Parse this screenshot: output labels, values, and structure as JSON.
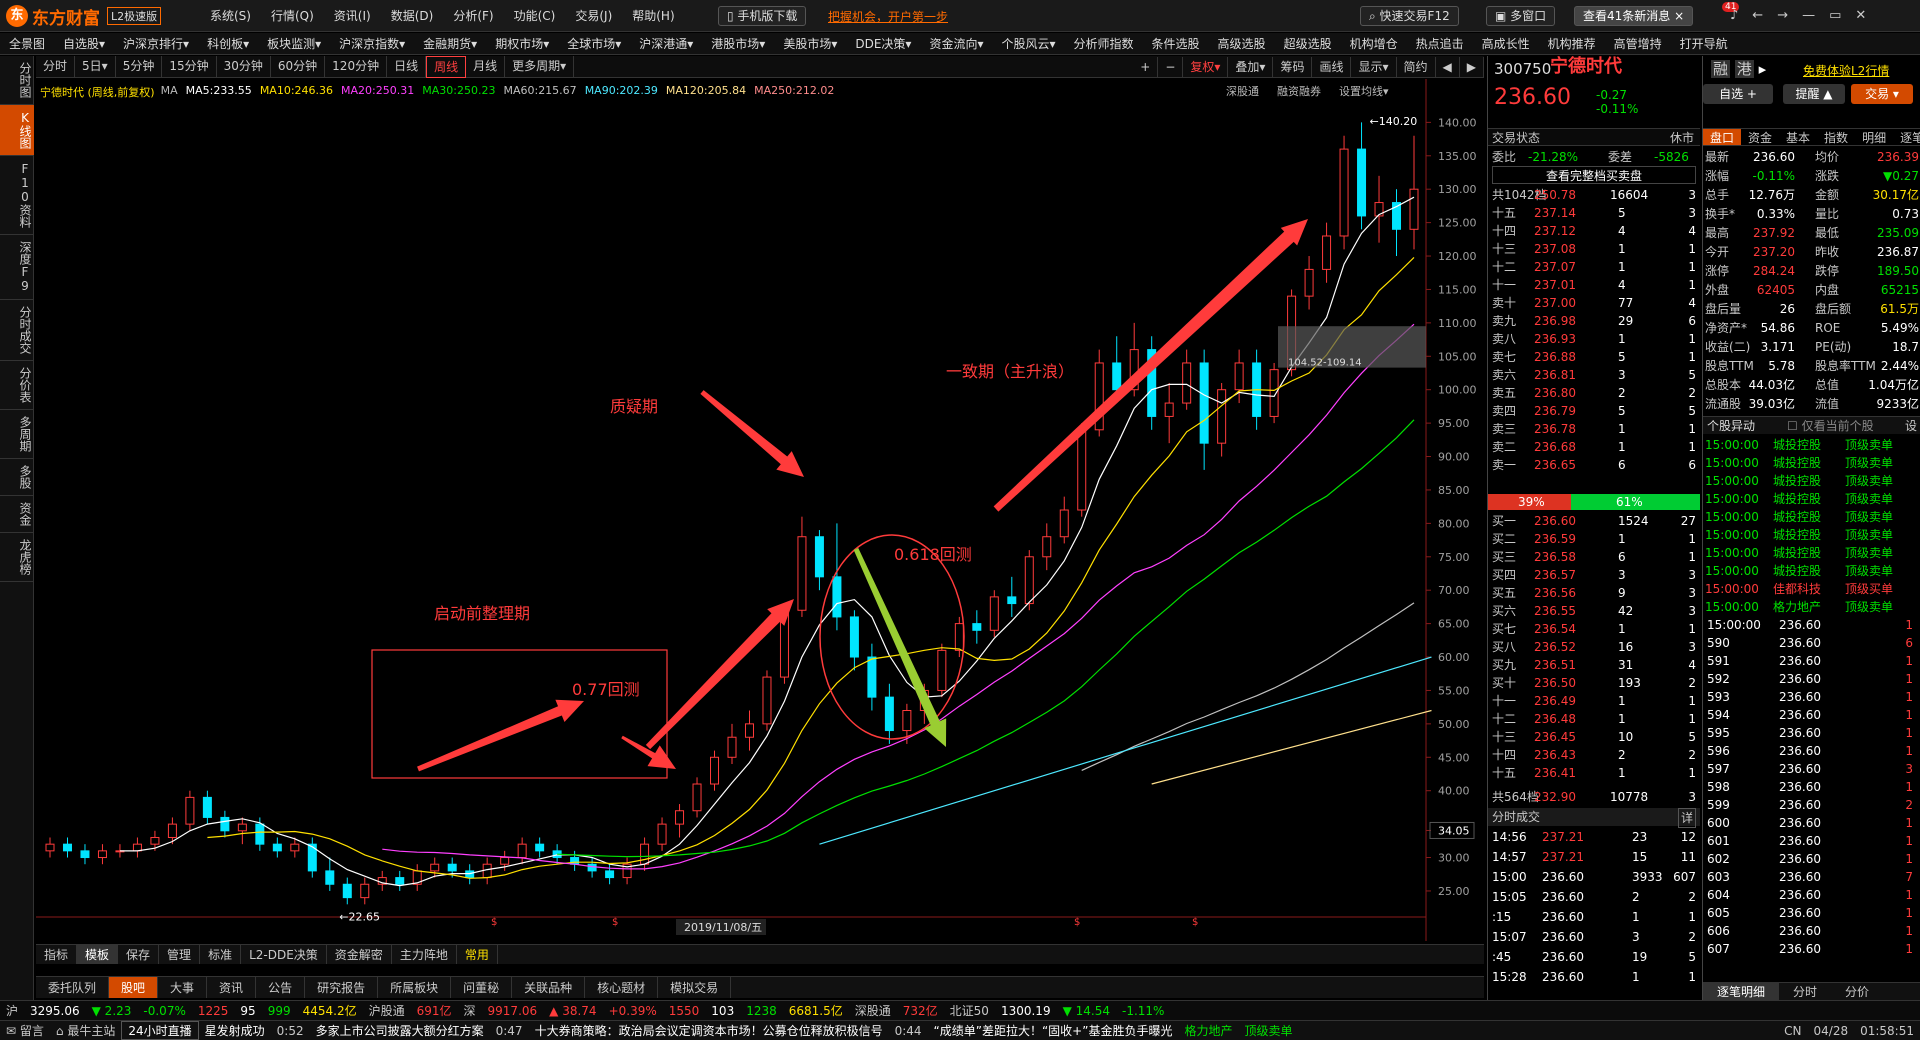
{
  "app": {
    "logo_text": "东方财富",
    "logo_sub": "L2极速版",
    "mobile_btn": "手机版下载",
    "promo": "把握机会，开户第一步",
    "quick_trade": "快速交易F12",
    "multi_window": "多窗口",
    "news": "查看41条新消息",
    "news_badge": "41"
  },
  "main_menu": [
    "系统(S)",
    "行情(Q)",
    "资讯(I)",
    "数据(D)",
    "分析(F)",
    "功能(C)",
    "交易(J)",
    "帮助(H)"
  ],
  "menubar": [
    "全景图",
    "自选股▾",
    "沪深京排行▾",
    "科创板▾",
    "板块监测▾",
    "沪深京指数▾",
    "金融期货▾",
    "期权市场▾",
    "全球市场▾",
    "沪深港通▾",
    "港股市场▾",
    "美股市场▾",
    "DDE决策▾",
    "资金流向▾",
    "个股风云▾",
    "分析师指数",
    "条件选股",
    "高级选股",
    "超级选股",
    "机构增仓",
    "热点追击",
    "高成长性",
    "机构推荐",
    "高管增持",
    "打开导航"
  ],
  "left_tabs": [
    "分时图",
    "K线图",
    "F10资料",
    "深度F9",
    "分时成交",
    "分价表",
    "多周期",
    "多股",
    "资金",
    "龙虎榜"
  ],
  "period_bar": [
    "分时",
    "5日▾",
    "5分钟",
    "15分钟",
    "30分钟",
    "60分钟",
    "120分钟",
    "日线",
    "周线",
    "月线",
    "更多周期▾"
  ],
  "period_active": "周线",
  "tool_bar": [
    "复权▾",
    "叠加▾",
    "筹码",
    "画线",
    "显示▾",
    "简约"
  ],
  "chart_subbar": [
    "深股通",
    "融资融券",
    "设置均线▾"
  ],
  "chart_data": {
    "type": "candlestick",
    "title": "宁德时代 (周线,前复权)",
    "ma_labels": [
      {
        "name": "MA5",
        "value": "233.55",
        "color": "#ffffff"
      },
      {
        "name": "MA10",
        "value": "246.36",
        "color": "#ffe000"
      },
      {
        "name": "MA20",
        "value": "250.31",
        "color": "#ff40ff"
      },
      {
        "name": "MA30",
        "value": "250.23",
        "color": "#00e000"
      },
      {
        "name": "MA60",
        "value": "215.67",
        "color": "#c0c0c0"
      },
      {
        "name": "MA90",
        "value": "202.39",
        "color": "#4de8ff"
      },
      {
        "name": "MA120",
        "value": "205.84",
        "color": "#ffe08c"
      },
      {
        "name": "MA250",
        "value": "212.02",
        "color": "#ff8c8c"
      }
    ],
    "y_ticks": [
      "140.00",
      "135.00",
      "130.00",
      "125.00",
      "120.00",
      "115.00",
      "110.00",
      "105.00",
      "100.00",
      "95.00",
      "90.00",
      "85.00",
      "80.00",
      "75.00",
      "70.00",
      "65.00",
      "60.00",
      "55.00",
      "50.00",
      "45.00",
      "40.00",
      "34.05",
      "30.00",
      "25.00"
    ],
    "ylim": [
      22,
      142
    ],
    "high_label": "140.20",
    "low_label": "22.65",
    "box_label": "104.52-109.14",
    "date_label": "2019/11/08/五",
    "candles": [
      [
        31,
        33,
        30,
        32
      ],
      [
        32,
        33,
        30,
        31
      ],
      [
        31,
        32,
        29,
        30
      ],
      [
        30,
        32,
        29,
        31
      ],
      [
        31,
        32,
        30,
        31
      ],
      [
        31,
        33,
        30,
        32
      ],
      [
        32,
        34,
        31,
        33
      ],
      [
        33,
        36,
        32,
        35
      ],
      [
        35,
        40,
        34,
        39
      ],
      [
        39,
        40,
        35,
        36
      ],
      [
        36,
        37,
        33,
        34
      ],
      [
        34,
        36,
        32,
        35
      ],
      [
        35,
        36,
        31,
        32
      ],
      [
        32,
        33,
        30,
        31
      ],
      [
        31,
        33,
        30,
        32
      ],
      [
        32,
        33,
        27,
        28
      ],
      [
        28,
        30,
        25,
        26
      ],
      [
        26,
        27,
        23,
        24
      ],
      [
        24,
        27,
        23,
        26
      ],
      [
        26,
        28,
        25,
        27
      ],
      [
        27,
        28,
        25,
        26
      ],
      [
        26,
        29,
        25,
        28
      ],
      [
        28,
        30,
        27,
        29
      ],
      [
        29,
        30,
        27,
        28
      ],
      [
        28,
        29,
        26,
        27
      ],
      [
        27,
        30,
        26,
        29
      ],
      [
        29,
        31,
        28,
        30
      ],
      [
        30,
        33,
        29,
        32
      ],
      [
        32,
        33,
        30,
        31
      ],
      [
        31,
        32,
        29,
        30
      ],
      [
        30,
        31,
        28,
        29
      ],
      [
        29,
        30,
        27,
        28
      ],
      [
        28,
        29,
        26,
        27
      ],
      [
        27,
        30,
        26,
        29
      ],
      [
        29,
        33,
        28,
        32
      ],
      [
        32,
        36,
        31,
        35
      ],
      [
        35,
        38,
        33,
        37
      ],
      [
        37,
        42,
        36,
        41
      ],
      [
        41,
        46,
        40,
        45
      ],
      [
        45,
        50,
        44,
        48
      ],
      [
        48,
        52,
        46,
        50
      ],
      [
        50,
        58,
        49,
        57
      ],
      [
        57,
        68,
        56,
        67
      ],
      [
        67,
        81,
        66,
        78
      ],
      [
        78,
        79,
        70,
        72
      ],
      [
        72,
        80,
        64,
        66
      ],
      [
        66,
        67,
        58,
        60
      ],
      [
        60,
        62,
        52,
        54
      ],
      [
        54,
        56,
        47,
        49
      ],
      [
        49,
        53,
        47,
        52
      ],
      [
        52,
        56,
        50,
        55
      ],
      [
        55,
        62,
        54,
        61
      ],
      [
        61,
        66,
        60,
        65
      ],
      [
        65,
        67,
        62,
        64
      ],
      [
        64,
        70,
        63,
        69
      ],
      [
        69,
        72,
        66,
        68
      ],
      [
        68,
        76,
        67,
        75
      ],
      [
        75,
        80,
        73,
        78
      ],
      [
        78,
        84,
        77,
        82
      ],
      [
        82,
        95,
        81,
        94
      ],
      [
        94,
        106,
        93,
        104
      ],
      [
        104,
        108,
        98,
        100
      ],
      [
        100,
        110,
        99,
        106
      ],
      [
        106,
        108,
        94,
        96
      ],
      [
        96,
        101,
        92,
        98
      ],
      [
        98,
        106,
        97,
        104
      ],
      [
        104,
        106,
        88,
        92
      ],
      [
        92,
        101,
        90,
        100
      ],
      [
        100,
        106,
        98,
        104
      ],
      [
        104,
        106,
        94,
        96
      ],
      [
        96,
        104,
        95,
        103
      ],
      [
        103,
        115,
        102,
        114
      ],
      [
        114,
        120,
        112,
        118
      ],
      [
        118,
        125,
        116,
        123
      ],
      [
        123,
        138,
        121,
        136
      ],
      [
        136,
        140,
        124,
        126
      ],
      [
        126,
        132,
        122,
        128
      ],
      [
        128,
        130,
        120,
        124
      ],
      [
        124,
        138,
        121,
        130
      ]
    ]
  },
  "annotations": {
    "consolidation": "启动前整理期",
    "retrace077": "0.77回测",
    "doubt": "质疑期",
    "retrace0618": "0.618回测",
    "consensus": "一致期（主升浪）"
  },
  "bottom_tabs": [
    "指标",
    "模板",
    "保存",
    "管理",
    "标准",
    "L2-DDE决策",
    "资金解密",
    "主力阵地",
    "常用"
  ],
  "bottom_tabs2": [
    "委托队列",
    "股吧",
    "大事",
    "资讯",
    "公告",
    "研究报告",
    "所属板块",
    "问董秘",
    "关联品种",
    "核心题材",
    "模拟交易"
  ],
  "stock": {
    "code": "300750",
    "name": "宁德时代",
    "price": "236.60",
    "change": "-0.27",
    "change_pct": "-0.11%",
    "l2_link": "免费体验L2行情",
    "add_fav": "自选 +",
    "remind": "提醒",
    "trade": "交易"
  },
  "order_book": {
    "status_label": "交易状态",
    "status": "休市",
    "weibi_label": "委比",
    "weibi": "-21.28%",
    "weicha_label": "委差",
    "weicha": "-5826",
    "full_depth": "查看完整档买卖盘",
    "sell_total_label": "共1042档",
    "sell_total_price": "250.78",
    "sell_total_vol": "16604",
    "sell_total_n": "3",
    "sells": [
      [
        "十五",
        "237.14",
        "5",
        "3"
      ],
      [
        "十四",
        "237.12",
        "4",
        "4"
      ],
      [
        "十三",
        "237.08",
        "1",
        "1"
      ],
      [
        "十二",
        "237.07",
        "1",
        "1"
      ],
      [
        "十一",
        "237.01",
        "4",
        "1"
      ],
      [
        "卖十",
        "237.00",
        "77",
        "4"
      ],
      [
        "卖九",
        "236.98",
        "29",
        "6"
      ],
      [
        "卖八",
        "236.93",
        "1",
        "1"
      ],
      [
        "卖七",
        "236.88",
        "5",
        "1"
      ],
      [
        "卖六",
        "236.81",
        "3",
        "5"
      ],
      [
        "卖五",
        "236.80",
        "2",
        "2"
      ],
      [
        "卖四",
        "236.79",
        "5",
        "5"
      ],
      [
        "卖三",
        "236.78",
        "1",
        "1"
      ],
      [
        "卖二",
        "236.68",
        "1",
        "1"
      ],
      [
        "卖一",
        "236.65",
        "6",
        "6"
      ]
    ],
    "ratio_sell": "39%",
    "ratio_buy": "61%",
    "buys": [
      [
        "买一",
        "236.60",
        "1524",
        "27"
      ],
      [
        "买二",
        "236.59",
        "1",
        "1"
      ],
      [
        "买三",
        "236.58",
        "6",
        "1"
      ],
      [
        "买四",
        "236.57",
        "3",
        "3"
      ],
      [
        "买五",
        "236.56",
        "9",
        "3"
      ],
      [
        "买六",
        "236.55",
        "42",
        "3"
      ],
      [
        "买七",
        "236.54",
        "1",
        "1"
      ],
      [
        "买八",
        "236.52",
        "16",
        "3"
      ],
      [
        "买九",
        "236.51",
        "31",
        "4"
      ],
      [
        "买十",
        "236.50",
        "193",
        "2"
      ],
      [
        "十一",
        "236.49",
        "1",
        "1"
      ],
      [
        "十二",
        "236.48",
        "1",
        "1"
      ],
      [
        "十三",
        "236.45",
        "10",
        "5"
      ],
      [
        "十四",
        "236.43",
        "2",
        "2"
      ],
      [
        "十五",
        "236.41",
        "1",
        "1"
      ]
    ],
    "buy_total_label": "共564档",
    "buy_total_price": "232.90",
    "buy_total_vol": "10778",
    "buy_total_n": "3"
  },
  "ticks_title": "分时成交",
  "ticks_detail": "详",
  "ticks": [
    [
      "14:56",
      "237.21",
      "23",
      "12"
    ],
    [
      "14:57",
      "237.21",
      "15",
      "11"
    ],
    [
      "15:00",
      "236.60",
      "3933",
      "607"
    ],
    [
      "15:05",
      "236.60",
      "2",
      "2"
    ],
    [
      ":15",
      "236.60",
      "1",
      "1"
    ],
    [
      "15:07",
      "236.60",
      "3",
      "2"
    ],
    [
      ":45",
      "236.60",
      "19",
      "5"
    ],
    [
      "15:28",
      "236.60",
      "1",
      "1"
    ]
  ],
  "right2_tabs": [
    "盘口",
    "资金",
    "基本",
    "指数",
    "明细",
    "逐笔"
  ],
  "quote": [
    [
      "最新",
      "236.60",
      "均价",
      "236.39"
    ],
    [
      "涨幅",
      "-0.11%",
      "涨跌",
      "▼0.27"
    ],
    [
      "总手",
      "12.76万",
      "金额",
      "30.17亿"
    ],
    [
      "换手*",
      "0.33%",
      "量比",
      "0.73"
    ],
    [
      "最高",
      "237.92",
      "最低",
      "235.09"
    ],
    [
      "今开",
      "237.20",
      "昨收",
      "236.87"
    ],
    [
      "涨停",
      "284.24",
      "跌停",
      "189.50"
    ],
    [
      "外盘",
      "62405",
      "内盘",
      "65215"
    ],
    [
      "盘后量",
      "26",
      "盘后额",
      "61.5万"
    ],
    [
      "净资产*",
      "54.86",
      "ROE",
      "5.49%"
    ],
    [
      "收益(二)",
      "3.171",
      "PE(动)",
      "18.7"
    ],
    [
      "股息TTM",
      "5.78",
      "股息率TTM",
      "2.44%"
    ],
    [
      "总股本",
      "44.03亿",
      "总值",
      "1.04万亿"
    ],
    [
      "流通股",
      "39.03亿",
      "流值",
      "9233亿"
    ]
  ],
  "anomaly_title": "个股异动",
  "anomaly_check": "仅看当前个股",
  "anomaly_set": "设",
  "anomalies": [
    [
      "15:00:00",
      "城投控股",
      "顶级卖单"
    ],
    [
      "15:00:00",
      "城投控股",
      "顶级卖单"
    ],
    [
      "15:00:00",
      "城投控股",
      "顶级卖单"
    ],
    [
      "15:00:00",
      "城投控股",
      "顶级卖单"
    ],
    [
      "15:00:00",
      "城投控股",
      "顶级卖单"
    ],
    [
      "15:00:00",
      "城投控股",
      "顶级卖单"
    ],
    [
      "15:00:00",
      "城投控股",
      "顶级卖单"
    ],
    [
      "15:00:00",
      "城投控股",
      "顶级卖单"
    ],
    [
      "15:00:00",
      "佳都科技",
      "顶级买单"
    ],
    [
      "15:00:00",
      "格力地产",
      "顶级卖单"
    ]
  ],
  "zhubi": [
    [
      "15:00:00",
      "236.60",
      "1"
    ],
    [
      "590",
      "236.60",
      "6"
    ],
    [
      "591",
      "236.60",
      "1"
    ],
    [
      "592",
      "236.60",
      "1"
    ],
    [
      "593",
      "236.60",
      "1"
    ],
    [
      "594",
      "236.60",
      "1"
    ],
    [
      "595",
      "236.60",
      "1"
    ],
    [
      "596",
      "236.60",
      "1"
    ],
    [
      "597",
      "236.60",
      "3"
    ],
    [
      "598",
      "236.60",
      "1"
    ],
    [
      "599",
      "236.60",
      "2"
    ],
    [
      "600",
      "236.60",
      "1"
    ],
    [
      "601",
      "236.60",
      "1"
    ],
    [
      "602",
      "236.60",
      "1"
    ],
    [
      "603",
      "236.60",
      "7"
    ],
    [
      "604",
      "236.60",
      "1"
    ],
    [
      "605",
      "236.60",
      "1"
    ],
    [
      "606",
      "236.60",
      "1"
    ],
    [
      "607",
      "236.60",
      "1"
    ]
  ],
  "zhubi_tabs": [
    "逐笔明细",
    "分时",
    "分价"
  ],
  "status": {
    "sh_label": "沪",
    "sh": "3295.06",
    "sh_ch": "▼ 2.23",
    "sh_pct": "-0.07%",
    "sh_n": "1225",
    "sh_n2": "95",
    "sh_n3": "999",
    "sh_amt": "4454.2亿",
    "hgt_label": "沪股通",
    "hgt": "691亿",
    "sz_label": "深",
    "sz": "9917.06",
    "sz_ch": "▲ 38.74",
    "sz_pct": "+0.39%",
    "sz_n": "1550",
    "sz_n2": "103",
    "sz_n3": "1238",
    "sz_amt": "6681.5亿",
    "sgt_label": "深股通",
    "sgt": "732亿",
    "bz_label": "北证50",
    "bz": "1300.19",
    "bz_ch": "▼ 14.54",
    "bz_pct": "-1.11%"
  },
  "ticker": {
    "msg": "留言",
    "site": "最牛主站",
    "live": "24小时直播",
    "star": "星发射成功",
    "t1": "0:52",
    "n1": "多家上市公司披露大额分红方案",
    "t2": "0:47",
    "n2": "十大券商策略：政治局会议定调资本市场！公募仓位释放积极信号",
    "t3": "0:44",
    "n3": "“成绩单”差距拉大！“固收+”基金胜负手曝光",
    "n4": "格力地产",
    "n5": "顶级卖单",
    "region": "CN",
    "date": "04/28",
    "time": "01:58:51"
  }
}
